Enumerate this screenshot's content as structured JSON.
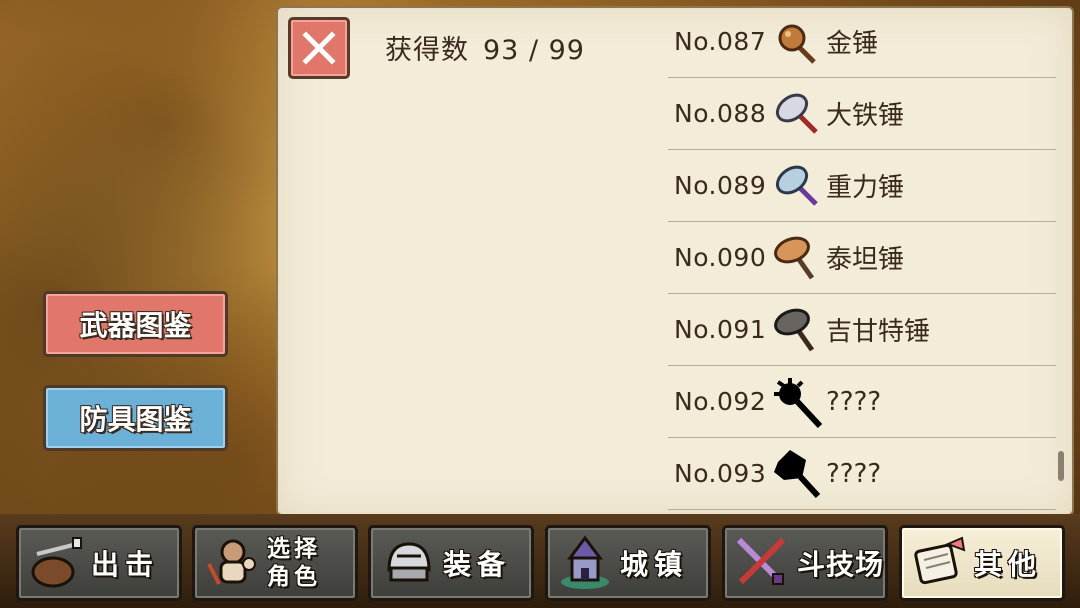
{
  "header": {
    "count_label": "获得数",
    "count_value": "93 / 99"
  },
  "side_menu": {
    "weapon_label": "武器图鉴",
    "armor_label": "防具图鉴"
  },
  "entries": [
    {
      "no": "No.087",
      "name": "金锤",
      "icon": "gold-hammer-icon",
      "color": "#c07a3a"
    },
    {
      "no": "No.088",
      "name": "大铁锤",
      "icon": "big-iron-hammer-icon",
      "color": "#d8d8e4"
    },
    {
      "no": "No.089",
      "name": "重力锤",
      "icon": "gravity-hammer-icon",
      "color": "#b8cfe0"
    },
    {
      "no": "No.090",
      "name": "泰坦锤",
      "icon": "titan-hammer-icon",
      "color": "#d8955a"
    },
    {
      "no": "No.091",
      "name": "吉甘特锤",
      "icon": "gigant-hammer-icon",
      "color": "#6a6460"
    },
    {
      "no": "No.092",
      "name": "????",
      "icon": "unknown-silhouette-icon",
      "color": "#000000"
    },
    {
      "no": "No.093",
      "name": "????",
      "icon": "unknown-silhouette-icon",
      "color": "#000000"
    }
  ],
  "nav": [
    {
      "label": "出击",
      "icon": "sortie-pot-icon"
    },
    {
      "label": "选择角色",
      "line1": "选择",
      "line2": "角色",
      "icon": "character-select-icon"
    },
    {
      "label": "装备",
      "icon": "armor-helmet-icon"
    },
    {
      "label": "城镇",
      "icon": "town-castle-icon"
    },
    {
      "label": "斗技场",
      "icon": "arena-swords-icon"
    },
    {
      "label": "其他",
      "icon": "other-scroll-icon",
      "active": true
    }
  ]
}
